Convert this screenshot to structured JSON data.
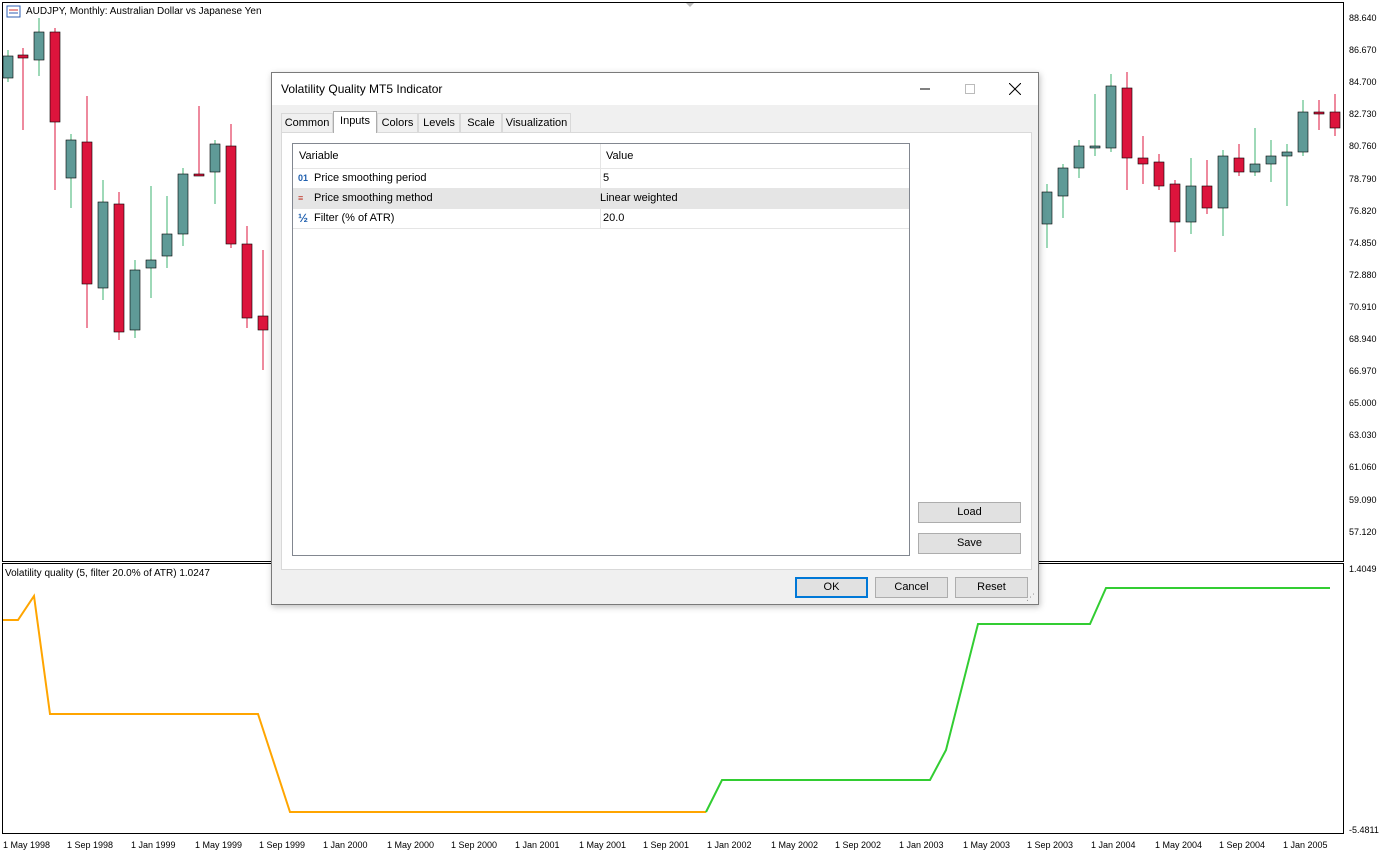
{
  "main_chart": {
    "title": "AUDJPY, Monthly:  Australian Dollar vs Japanese Yen",
    "icon": "chart-window-icon",
    "price_labels": [
      "88.640",
      "86.670",
      "84.700",
      "82.730",
      "80.760",
      "78.790",
      "76.820",
      "74.850",
      "72.880",
      "70.910",
      "68.940",
      "66.970",
      "65.000",
      "63.030",
      "61.060",
      "59.090",
      "57.120"
    ],
    "colors": {
      "bull": "#5f9a97",
      "bear": "#dc143c",
      "wick_bull": "#3cb371",
      "wick_bear": "#dc143c"
    }
  },
  "sub_chart": {
    "title": "Volatility quality (5, filter 20.0% of ATR) 1.0247",
    "top_label": "1.4049",
    "bottom_label": "-5.4811",
    "colors": {
      "down": "#ffa500",
      "up": "#32cd32"
    }
  },
  "time_axis": [
    "1 May 1998",
    "1 Sep 1998",
    "1 Jan 1999",
    "1 May 1999",
    "1 Sep 1999",
    "1 Jan 2000",
    "1 May 2000",
    "1 Sep 2000",
    "1 Jan 2001",
    "1 May 2001",
    "1 Sep 2001",
    "1 Jan 2002",
    "1 May 2002",
    "1 Sep 2002",
    "1 Jan 2003",
    "1 May 2003",
    "1 Sep 2003",
    "1 Jan 2004",
    "1 May 2004",
    "1 Sep 2004",
    "1 Jan 2005"
  ],
  "dialog": {
    "title": "Volatility Quality MT5 Indicator",
    "tabs": [
      {
        "label": "Common"
      },
      {
        "label": "Inputs"
      },
      {
        "label": "Colors"
      },
      {
        "label": "Levels"
      },
      {
        "label": "Scale"
      },
      {
        "label": "Visualization"
      }
    ],
    "active_tab": "Inputs",
    "grid": {
      "col_variable": "Variable",
      "col_value": "Value",
      "rows": [
        {
          "icon": "integer-icon",
          "icon_glyph": "01",
          "variable": "Price smoothing period",
          "value": "5"
        },
        {
          "icon": "enum-list-icon",
          "icon_glyph": "≡",
          "variable": "Price smoothing method",
          "value": "Linear weighted"
        },
        {
          "icon": "fraction-icon",
          "icon_glyph": "½",
          "variable": "Filter (% of ATR)",
          "value": "20.0"
        }
      ]
    },
    "buttons": {
      "load": "Load",
      "save": "Save",
      "ok": "OK",
      "cancel": "Cancel",
      "reset": "Reset"
    }
  }
}
